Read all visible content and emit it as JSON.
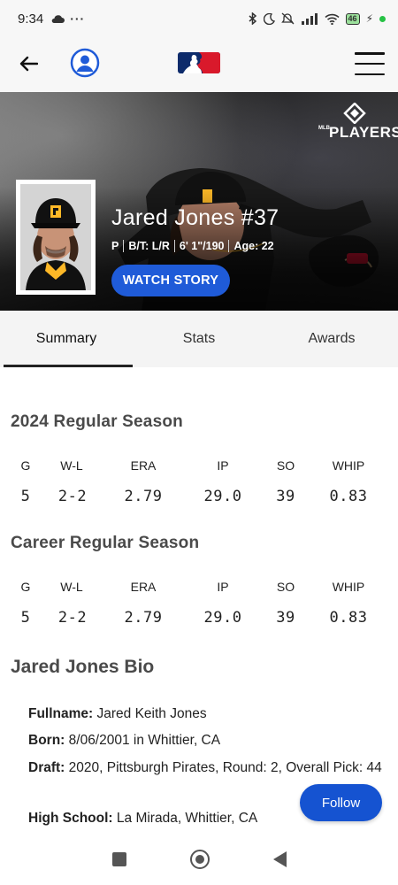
{
  "status_bar": {
    "time": "9:34",
    "battery_level": "46"
  },
  "hero": {
    "players_logo_text": "PLAYERS",
    "players_logo_small": "MLB",
    "player_name": "Jared Jones #37",
    "position": "P",
    "bats_throws": "B/T: L/R",
    "height_weight": "6' 1\"/190",
    "age": "Age: 22",
    "watch_story_label": "WATCH STORY"
  },
  "tabs": [
    {
      "label": "Summary",
      "active": true
    },
    {
      "label": "Stats",
      "active": false
    },
    {
      "label": "Awards",
      "active": false
    }
  ],
  "season_2024": {
    "title": "2024 Regular Season",
    "headers": [
      "G",
      "W-L",
      "ERA",
      "IP",
      "SO",
      "WHIP"
    ],
    "values": [
      "5",
      "2-2",
      "2.79",
      "29.0",
      "39",
      "0.83"
    ]
  },
  "career": {
    "title": "Career Regular Season",
    "headers": [
      "G",
      "W-L",
      "ERA",
      "IP",
      "SO",
      "WHIP"
    ],
    "values": [
      "5",
      "2-2",
      "2.79",
      "29.0",
      "39",
      "0.83"
    ]
  },
  "bio": {
    "title": "Jared Jones Bio",
    "fullname_label": "Fullname:",
    "fullname": "Jared Keith Jones",
    "born_label": "Born:",
    "born": "8/06/2001 in Whittier, CA",
    "draft_label": "Draft:",
    "draft": "2020, Pittsburgh Pirates, Round: 2, Overall Pick: 44",
    "high_school_label": "High School:",
    "high_school": "La Mirada, Whittier, CA"
  },
  "follow_label": "Follow",
  "colors": {
    "accent_blue": "#1f5bd8",
    "follow_blue": "#1553d1",
    "pirates_gold": "#fdb827"
  }
}
